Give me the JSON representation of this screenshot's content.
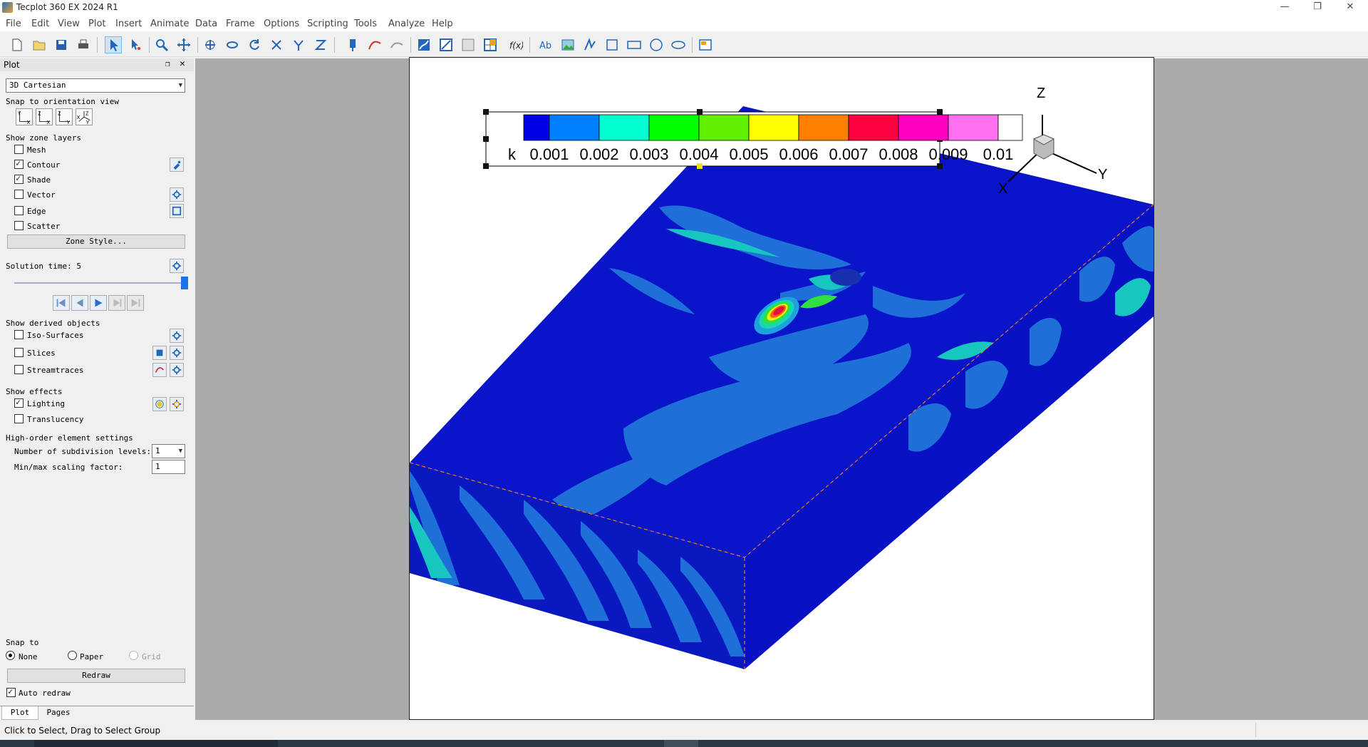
{
  "window": {
    "title": "Tecplot 360 EX 2024 R1"
  },
  "menu": [
    "File",
    "Edit",
    "View",
    "Plot",
    "Insert",
    "Animate",
    "Data",
    "Frame",
    "Options",
    "Scripting",
    "Tools",
    "Analyze",
    "Help"
  ],
  "sidebar": {
    "title": "Plot",
    "plot_type": "3D Cartesian",
    "snap_orientation_label": "Snap to orientation view",
    "show_zone_layers_label": "Show zone layers",
    "layers": [
      {
        "label": "Mesh",
        "checked": false
      },
      {
        "label": "Contour",
        "checked": true
      },
      {
        "label": "Shade",
        "checked": true
      },
      {
        "label": "Vector",
        "checked": false
      },
      {
        "label": "Edge",
        "checked": false
      },
      {
        "label": "Scatter",
        "checked": false
      }
    ],
    "zone_style_button": "Zone Style...",
    "solution_time_label": "Solution time: 5",
    "solution_time_slider": 1.0,
    "show_derived_label": "Show derived objects",
    "derived": [
      {
        "label": "Iso-Surfaces",
        "checked": false
      },
      {
        "label": "Slices",
        "checked": false
      },
      {
        "label": "Streamtraces",
        "checked": false
      }
    ],
    "show_effects_label": "Show effects",
    "effects": [
      {
        "label": "Lighting",
        "checked": true
      },
      {
        "label": "Translucency",
        "checked": false
      }
    ],
    "high_order_label": "High-order element settings",
    "subdivision_label": "Number of subdivision levels:",
    "subdivision_value": "1",
    "scaling_label": "Min/max scaling factor:",
    "scaling_value": "1",
    "snap_to_label": "Snap to",
    "snap_options": [
      "None",
      "Paper",
      "Grid"
    ],
    "snap_selected": "None",
    "redraw_button": "Redraw",
    "auto_redraw_label": "Auto redraw",
    "auto_redraw_checked": true,
    "tabs": [
      "Plot",
      "Pages"
    ]
  },
  "legend": {
    "variable": "k",
    "levels": [
      "0.001",
      "0.002",
      "0.003",
      "0.004",
      "0.005",
      "0.006",
      "0.007",
      "0.008",
      "0.009",
      "0.01"
    ],
    "colors": [
      "#0000e6",
      "#0080ff",
      "#00ffd0",
      "#00ff00",
      "#60f000",
      "#ffff00",
      "#ff8000",
      "#ff0040",
      "#ff00c0",
      "#ff70f0",
      "#ffffff"
    ]
  },
  "axes": {
    "x": "X",
    "y": "Y",
    "z": "Z"
  },
  "status": {
    "message": "Click to Select, Drag to Select Group"
  }
}
